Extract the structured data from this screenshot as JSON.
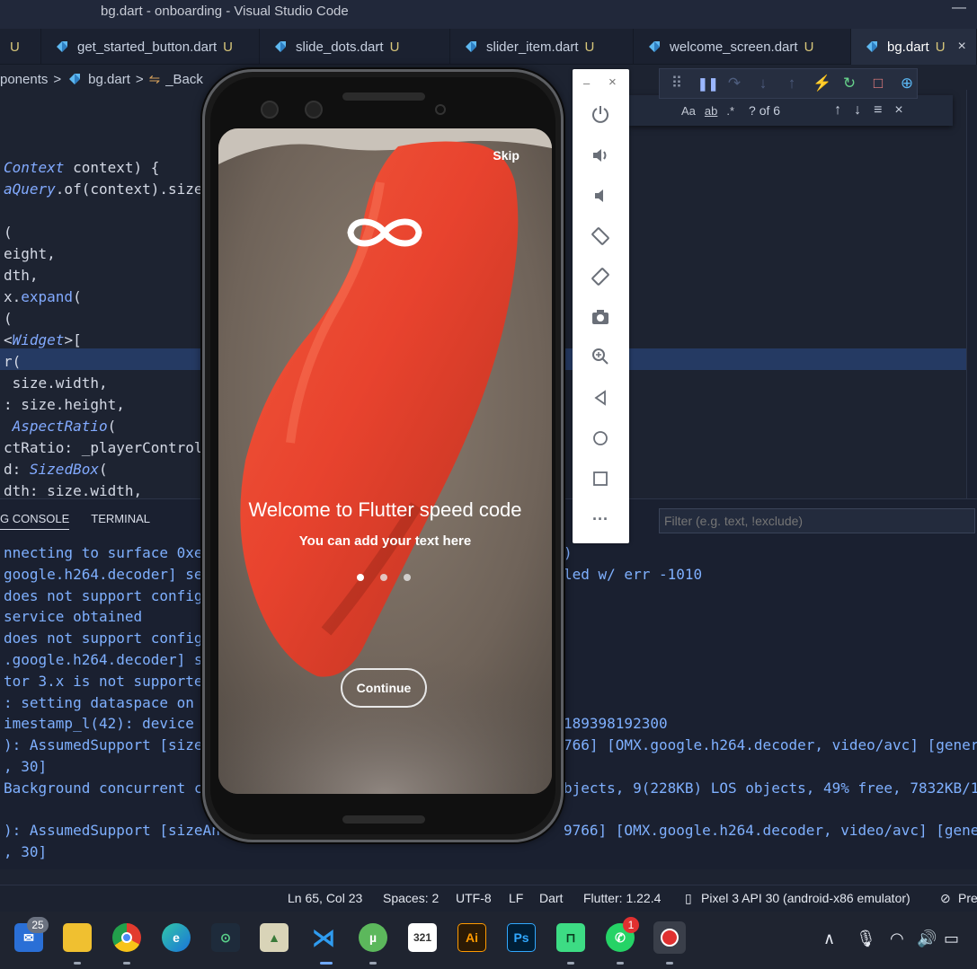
{
  "window": {
    "title": "bg.dart - onboarding - Visual Studio Code",
    "minimize": "—"
  },
  "tabs": [
    {
      "label": "U",
      "modified": ""
    },
    {
      "label": "get_started_button.dart",
      "modified": "U"
    },
    {
      "label": "slide_dots.dart",
      "modified": "U"
    },
    {
      "label": "slider_item.dart",
      "modified": "U"
    },
    {
      "label": "welcome_screen.dart",
      "modified": "U"
    },
    {
      "label": "bg.dart",
      "modified": "U",
      "close": "×"
    }
  ],
  "breadcrumb": {
    "folder": "ponents",
    "sep": ">",
    "file": "bg.dart",
    "sep2": ">",
    "symbol": "_Back"
  },
  "code_lines": [
    {
      "a": "",
      "t": "Context",
      "b": " context) {"
    },
    {
      "a": "",
      "t": "aQuery",
      "b": ".of(context).size"
    },
    {
      "a": "",
      "t": "",
      "b": ""
    },
    {
      "a": "(",
      "t": "",
      "b": ""
    },
    {
      "a": "eight,",
      "t": "",
      "b": ""
    },
    {
      "a": "dth,",
      "t": "",
      "b": ""
    },
    {
      "a": "x.",
      "t": "expand",
      "b": "("
    },
    {
      "a": "(",
      "t": "",
      "b": ""
    },
    {
      "a": "<",
      "t": "Widget",
      "b": ">["
    },
    {
      "a": "r(",
      "t": "",
      "b": ""
    },
    {
      "a": " size.width,",
      "t": "",
      "b": ""
    },
    {
      "a": ": size.height,",
      "t": "",
      "b": ""
    },
    {
      "a": " ",
      "t": "AspectRatio",
      "b": "("
    },
    {
      "a": "ctRatio: _playerControl",
      "t": "",
      "b": ""
    },
    {
      "a": "d: ",
      "t": "SizedBox",
      "b": "("
    },
    {
      "a": "dth: size.width,",
      "t": "",
      "b": ""
    }
  ],
  "find": {
    "case": "Aa",
    "word": "ab",
    "regex": ".*",
    "count": "? of 6",
    "up": "↑",
    "down": "↓",
    "sel": "≡",
    "close": "×"
  },
  "debug": [
    "⠿",
    "❚❚",
    "↷",
    "↓",
    "↑",
    "⚡",
    "↻",
    "□",
    "⊕"
  ],
  "panel": {
    "tab_console": "G CONSOLE",
    "tab_terminal": "TERMINAL",
    "filter_placeholder": "Filter (e.g. text, !exclude)"
  },
  "console_lines": [
    {
      "l": "nnecting to surface 0xe",
      "r": ")"
    },
    {
      "l": "google.h264.decoder] set",
      "r": "led w/ err -1010"
    },
    {
      "l": "does not support config",
      "r": ""
    },
    {
      "l": "service obtained",
      "r": ""
    },
    {
      "l": "does not support config",
      "r": ""
    },
    {
      "l": ".google.h264.decoder] s",
      "r": ""
    },
    {
      "l": "tor 3.x is not supporte",
      "r": ""
    },
    {
      "l": ": setting dataspace on",
      "r": ""
    },
    {
      "l": "imestamp_l(42): device",
      "r": "189398192300"
    },
    {
      "l": "): AssumedSupport [size",
      "r": "766] [OMX.google.h264.decoder, video/avc] [generi"
    },
    {
      "l": ", 30]",
      "r": ""
    },
    {
      "l": "Background concurrent c",
      "r": "bjects, 9(228KB) LOS objects, 49% free, 7832KB/1"
    },
    {
      "l": "",
      "r": ""
    },
    {
      "l": "): AssumedSupport [sizeAn",
      "r": "9766] [OMX.google.h264.decoder, video/avc] [generi"
    },
    {
      "l": ", 30]",
      "r": ""
    }
  ],
  "status": {
    "position": "Ln 65, Col 23",
    "spaces": "Spaces: 2",
    "encoding": "UTF-8",
    "eol": "LF",
    "language": "Dart",
    "flutter": "Flutter: 1.22.4",
    "device": "Pixel 3 API 30 (android-x86 emulator)",
    "prettier": "Pre"
  },
  "emulator": {
    "header_min": "–",
    "header_close": "×",
    "buttons": [
      "power",
      "volume-up",
      "volume-down",
      "rotate-left",
      "rotate-right",
      "screenshot",
      "zoom",
      "back",
      "home",
      "overview",
      "more"
    ]
  },
  "app": {
    "skip": "Skip",
    "title": "Welcome to Flutter speed code",
    "subtitle": "You can add your text here",
    "continue": "Continue",
    "dots": 3,
    "active_dot": 0
  },
  "taskbar": {
    "mail_badge": "25",
    "whatsapp_badge": "1",
    "items": [
      "mail",
      "file-explorer",
      "chrome",
      "edge",
      "maps",
      "photos",
      "vs-code",
      "utorrent",
      "calendar",
      "illustrator",
      "photoshop",
      "android-studio",
      "whatsapp",
      "recorder"
    ]
  },
  "colors": {
    "accent_blue": "#82aaff",
    "highlight": "#253a63",
    "record_red": "#e03030"
  }
}
